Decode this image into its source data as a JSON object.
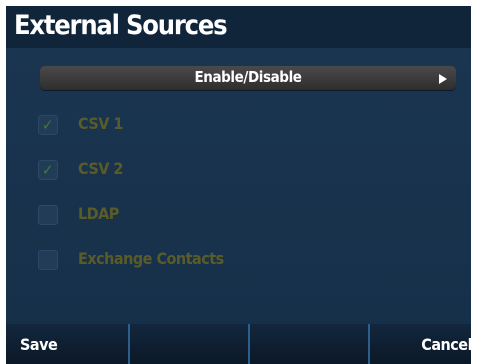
{
  "screen": {
    "title": "External Sources"
  },
  "selector": {
    "label": "Enable/Disable",
    "arrow_icon": "triangle-right-icon"
  },
  "options": [
    {
      "label": "CSV 1",
      "checked": true
    },
    {
      "label": "CSV 2",
      "checked": true
    },
    {
      "label": "LDAP",
      "checked": false
    },
    {
      "label": "Exchange Contacts",
      "checked": false
    }
  ],
  "check_glyph": "✓",
  "softkeys": [
    {
      "label": "Save"
    },
    {
      "label": ""
    },
    {
      "label": ""
    },
    {
      "label": "Cancel"
    }
  ],
  "colors": {
    "title_bar": "#10243a",
    "panel": "#1a3550",
    "option_text_disabled": "#5a5c28",
    "check_mark": "#3b7c3b",
    "softkey_divider": "#2b5f8d"
  }
}
